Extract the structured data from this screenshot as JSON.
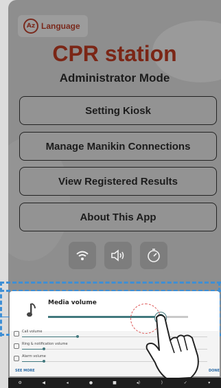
{
  "header": {
    "language_label": "Language",
    "language_icon": "language-icon"
  },
  "main": {
    "title": "CPR station",
    "subtitle": "Administrator Mode",
    "buttons": [
      {
        "label": "Setting Kiosk"
      },
      {
        "label": "Manage Manikin Connections"
      },
      {
        "label": "View Registered Results"
      },
      {
        "label": "About This App"
      }
    ],
    "quick_icons": [
      "wifi-icon",
      "volume-icon",
      "timer-icon"
    ]
  },
  "volume_panel": {
    "media_title": "Media volume",
    "media_level": 0.8,
    "rows": [
      {
        "label": "Call volume",
        "icon": "call-icon",
        "level": 0.3
      },
      {
        "label": "Ring & notification volume",
        "icon": "ring-icon",
        "level": 0.12
      },
      {
        "label": "Alarm volume",
        "icon": "alarm-icon",
        "level": 0.12
      }
    ],
    "see_more": "SEE MORE",
    "done": "DONE"
  },
  "colors": {
    "title": "#7b2616",
    "accent": "#41787d",
    "guide": "#3d8fd6"
  }
}
